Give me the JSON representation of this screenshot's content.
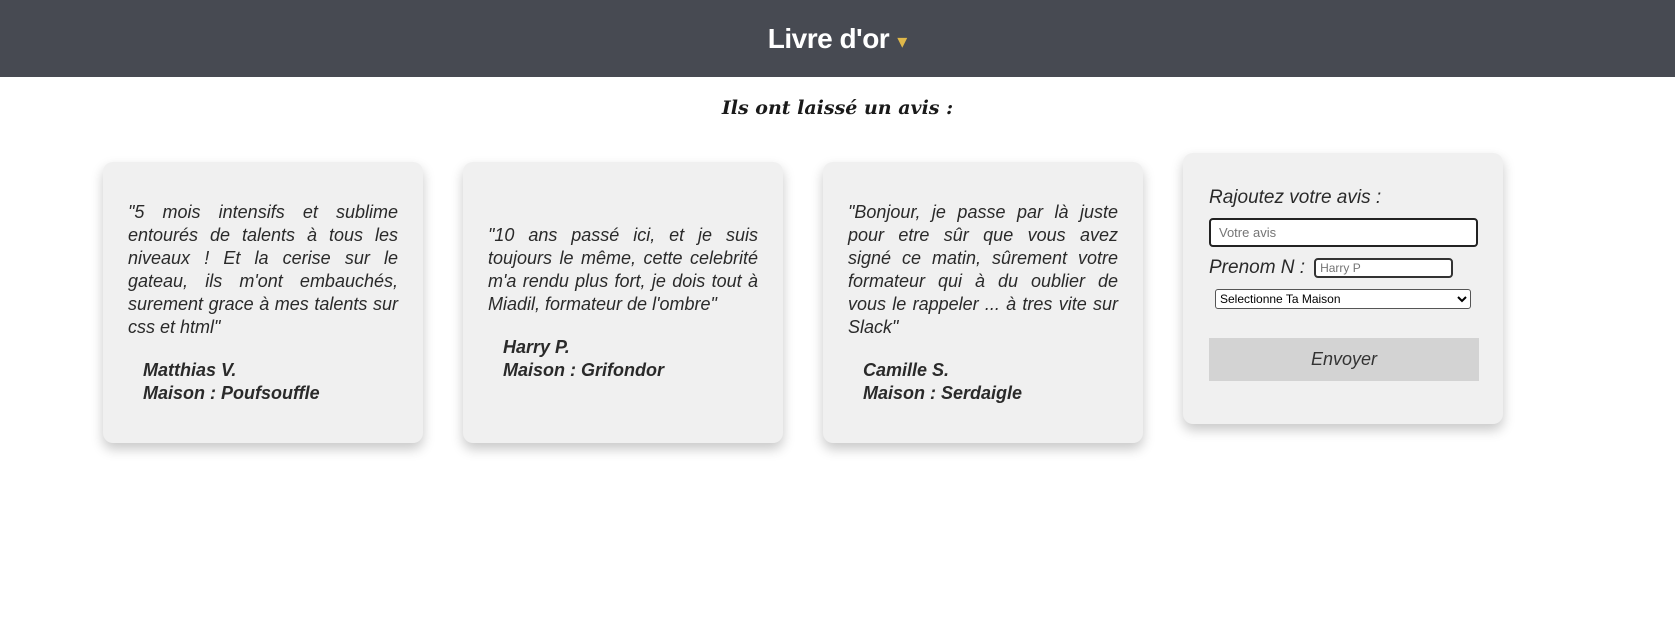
{
  "header": {
    "title": "Livre d'or",
    "caret": "▾"
  },
  "subtitle": "Ils ont laissé un avis :",
  "reviews": [
    {
      "quote": "\"5 mois intensifs et sublime entourés de talents à tous les niveaux ! Et la cerise sur le gateau, ils m'ont embauchés, surement grace à mes talents sur css et html\"",
      "name": "Matthias V.",
      "house": "Maison : Poufsouffle"
    },
    {
      "quote": "\"10 ans passé ici, et je suis toujours le même, cette celebrité m'a rendu plus fort, je dois tout à Miadil, formateur de l'ombre\"",
      "name": "Harry P.",
      "house": "Maison : Grifondor"
    },
    {
      "quote": "\"Bonjour, je passe par là juste pour etre sûr que vous avez signé ce matin, sûrement votre formateur qui à du oublier de vous le rappeler ... à tres vite sur Slack\"",
      "name": "Camille S.",
      "house": "Maison : Serdaigle"
    }
  ],
  "form": {
    "title": "Rajoutez votre avis :",
    "review_placeholder": "Votre avis",
    "name_label": "Prenom N :",
    "name_placeholder": "Harry P",
    "house_selected": "Selectionne Ta Maison",
    "submit_label": "Envoyer"
  },
  "colors": {
    "header_bg": "#474a52",
    "accent": "#e0b84a",
    "card_bg": "#f0f0f0",
    "button_bg": "#d3d3d3"
  }
}
